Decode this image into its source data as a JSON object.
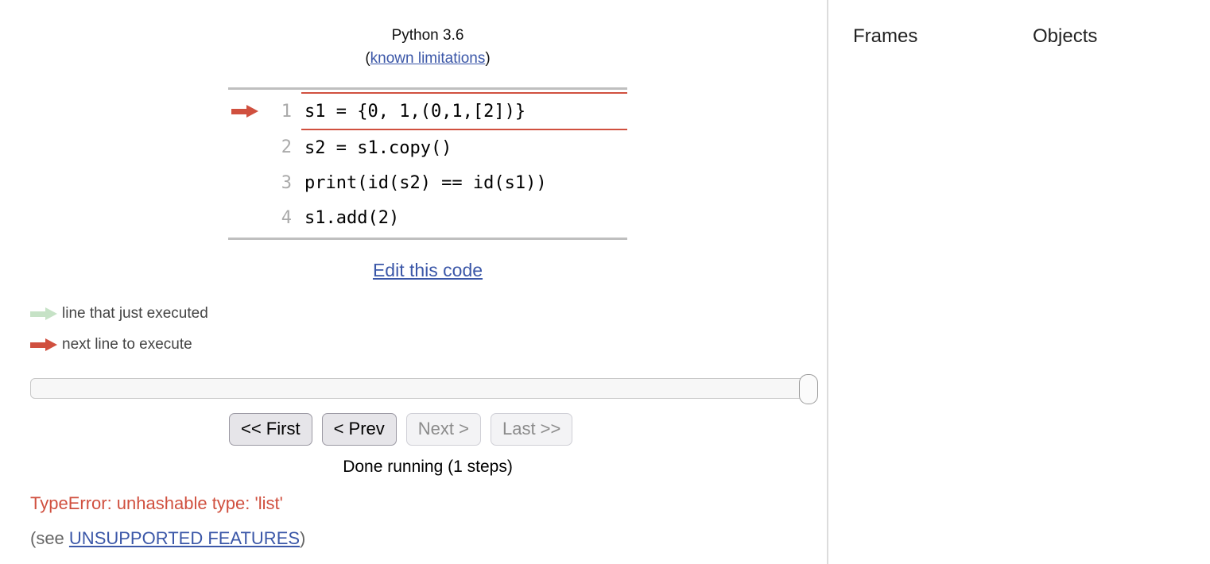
{
  "header": {
    "python_version": "Python 3.6",
    "limitations_prefix": "(",
    "limitations_link": "known limitations",
    "limitations_suffix": ")"
  },
  "code": {
    "lines": [
      {
        "number": "1",
        "text": "s1 = {0, 1,(0,1,[2])}",
        "highlighted": true,
        "arrow": "next"
      },
      {
        "number": "2",
        "text": "s2 = s1.copy()",
        "highlighted": false,
        "arrow": "none"
      },
      {
        "number": "3",
        "text": "print(id(s2) == id(s1))",
        "highlighted": false,
        "arrow": "none"
      },
      {
        "number": "4",
        "text": "s1.add(2)",
        "highlighted": false,
        "arrow": "none"
      }
    ]
  },
  "edit_code_link": "Edit this code",
  "legend": {
    "just_executed": "line that just executed",
    "next_line": "next line to execute"
  },
  "controls": {
    "buttons": [
      {
        "label": "<< First",
        "enabled": true
      },
      {
        "label": "< Prev",
        "enabled": true
      },
      {
        "label": "Next >",
        "enabled": false
      },
      {
        "label": "Last >>",
        "enabled": false
      }
    ],
    "status": "Done running (1 steps)"
  },
  "error": {
    "message": "TypeError: unhashable type: 'list'",
    "see_prefix": "(see ",
    "see_link": "UNSUPPORTED FEATURES",
    "see_suffix": ")"
  },
  "right_pane": {
    "frames_heading": "Frames",
    "objects_heading": "Objects"
  },
  "colors": {
    "next_arrow": "#d0503f",
    "executed_arrow": "#c6e2c6",
    "error_text": "#d0503f",
    "link": "#3b57a8"
  }
}
